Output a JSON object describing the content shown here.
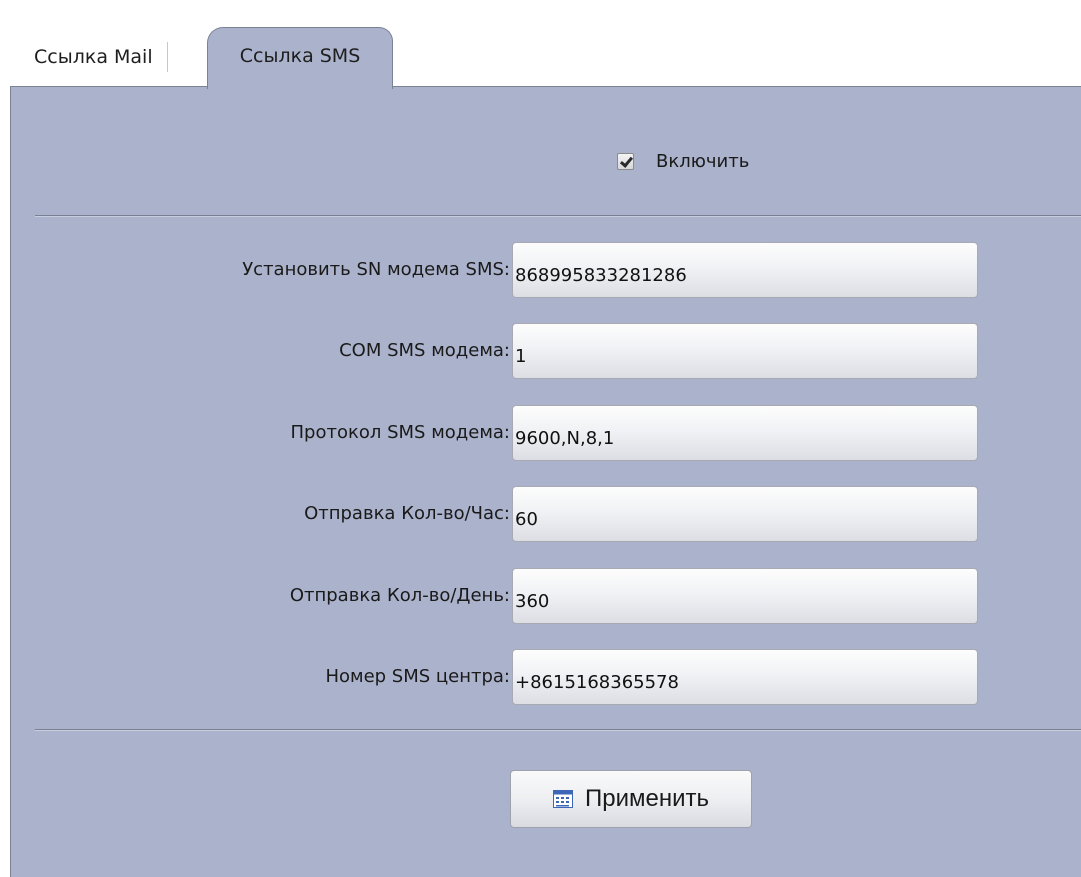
{
  "tabs": [
    {
      "label": "Ссылка Mail"
    },
    {
      "label": "Ссылка SMS"
    }
  ],
  "enable": {
    "label": "Включить",
    "checked": true
  },
  "fields": [
    {
      "label": "Установить SN модема SMS:",
      "value": "868995833281286"
    },
    {
      "label": "COM SMS модема:",
      "value": "1"
    },
    {
      "label": "Протокол SMS модема:",
      "value": "9600,N,8,1"
    },
    {
      "label": "Отправка Кол-во/Час:",
      "value": "60"
    },
    {
      "label": "Отправка Кол-во/День:",
      "value": "360"
    },
    {
      "label": "Номер SMS центра:",
      "value": "+8615168365578"
    }
  ],
  "apply_button": {
    "label": "Применить",
    "icon": "keyboard-icon"
  },
  "colors": {
    "panel_bg": "#abb2cb",
    "border": "#7c8296"
  }
}
